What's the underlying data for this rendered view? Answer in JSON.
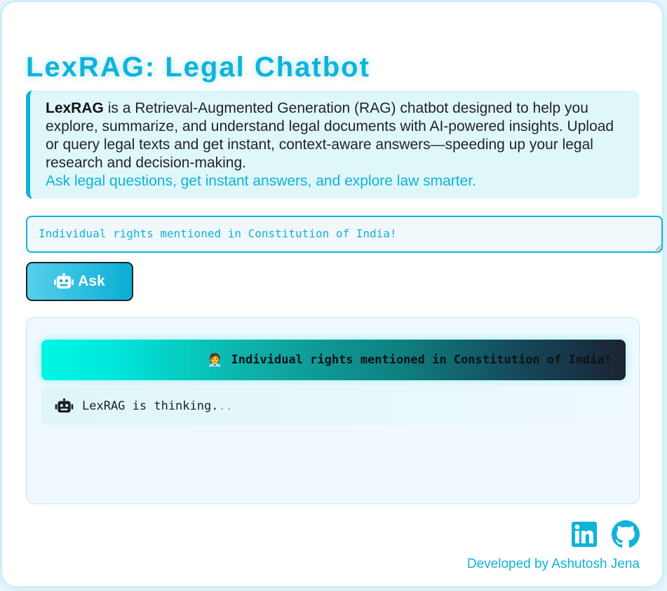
{
  "app": {
    "title": "LexRAG: Legal Chatbot",
    "accent_color": "#0eb3d9"
  },
  "intro": {
    "brand": "LexRAG",
    "description": " is a Retrieval-Augmented Generation (RAG) chatbot designed to help you explore, summarize, and understand legal documents with AI-powered insights. Upload or query legal texts and get instant, context-aware answers—speeding up your legal research and decision-making.",
    "tagline": "Ask legal questions, get instant answers, and explore law smarter."
  },
  "query": {
    "value": "Individual rights mentioned in Constitution of India!"
  },
  "ask_button": {
    "icon": "robot-icon",
    "label": "Ask"
  },
  "chat": {
    "messages": [
      {
        "role": "user",
        "icon": "person-emoji",
        "emoji": "🧑‍💼",
        "text": "Individual rights mentioned in Constitution of India!"
      },
      {
        "role": "bot",
        "icon": "robot-icon",
        "text": "LexRAG is thinking.",
        "dots": ".."
      }
    ]
  },
  "footer": {
    "linkedin_icon": "linkedin-icon",
    "github_icon": "github-icon",
    "credit": "Developed by Ashutosh Jena"
  }
}
